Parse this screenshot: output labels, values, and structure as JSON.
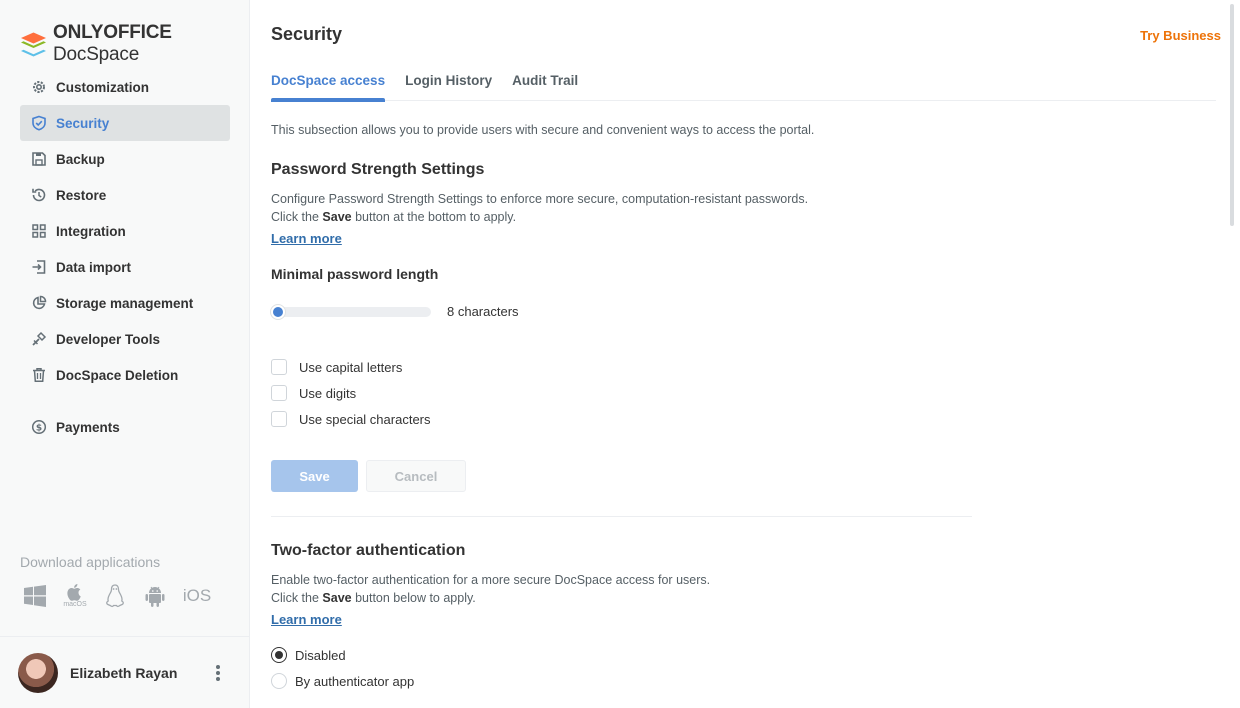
{
  "app": {
    "logo_bold": "ONLYOFFICE",
    "logo_light": "DocSpace"
  },
  "sidebar": {
    "items": [
      {
        "label": "Customization",
        "icon": "gear-icon"
      },
      {
        "label": "Security",
        "icon": "shield-icon"
      },
      {
        "label": "Backup",
        "icon": "save-icon"
      },
      {
        "label": "Restore",
        "icon": "restore-icon"
      },
      {
        "label": "Integration",
        "icon": "grid-icon"
      },
      {
        "label": "Data import",
        "icon": "import-icon"
      },
      {
        "label": "Storage management",
        "icon": "pie-chart-icon"
      },
      {
        "label": "Developer Tools",
        "icon": "wrench-icon"
      },
      {
        "label": "DocSpace Deletion",
        "icon": "trash-icon"
      },
      {
        "label": "Payments",
        "icon": "dollar-icon"
      }
    ],
    "active_index": 1,
    "download_label": "Download applications",
    "apps": [
      "windows-icon",
      "macos-icon",
      "linux-icon",
      "android-icon",
      "ios-icon"
    ],
    "macos_label": "macOS",
    "ios_label": "iOS"
  },
  "profile": {
    "name": "Elizabeth Rayan"
  },
  "header": {
    "title": "Security",
    "try_business": "Try Business"
  },
  "tabs": [
    {
      "label": "DocSpace access",
      "active": true
    },
    {
      "label": "Login History",
      "active": false
    },
    {
      "label": "Audit Trail",
      "active": false
    }
  ],
  "intro": "This subsection allows you to provide users with secure and convenient ways to access the portal.",
  "password": {
    "title": "Password Strength Settings",
    "desc_line1": "Configure Password Strength Settings to enforce more secure, computation-resistant passwords.",
    "desc_line2_pre": "Click the ",
    "desc_line2_bold": "Save",
    "desc_line2_post": " button at the bottom to apply.",
    "learn_more": "Learn more",
    "min_length_label": "Minimal password length",
    "slider_value": "8 characters",
    "checkboxes": [
      {
        "label": "Use capital letters",
        "checked": false
      },
      {
        "label": "Use digits",
        "checked": false
      },
      {
        "label": "Use special characters",
        "checked": false
      }
    ],
    "save_label": "Save",
    "cancel_label": "Cancel"
  },
  "twofa": {
    "title": "Two-factor authentication",
    "desc_line1": "Enable two-factor authentication for a more secure DocSpace access for users.",
    "desc_line2_pre": "Click the ",
    "desc_line2_bold": "Save",
    "desc_line2_post": " button below to apply.",
    "learn_more": "Learn more",
    "options": [
      {
        "label": "Disabled",
        "selected": true
      },
      {
        "label": "By authenticator app",
        "selected": false
      }
    ]
  },
  "colors": {
    "accent": "#4781d1",
    "try_business": "#ed7309",
    "save_disabled": "#a6c5ec"
  }
}
